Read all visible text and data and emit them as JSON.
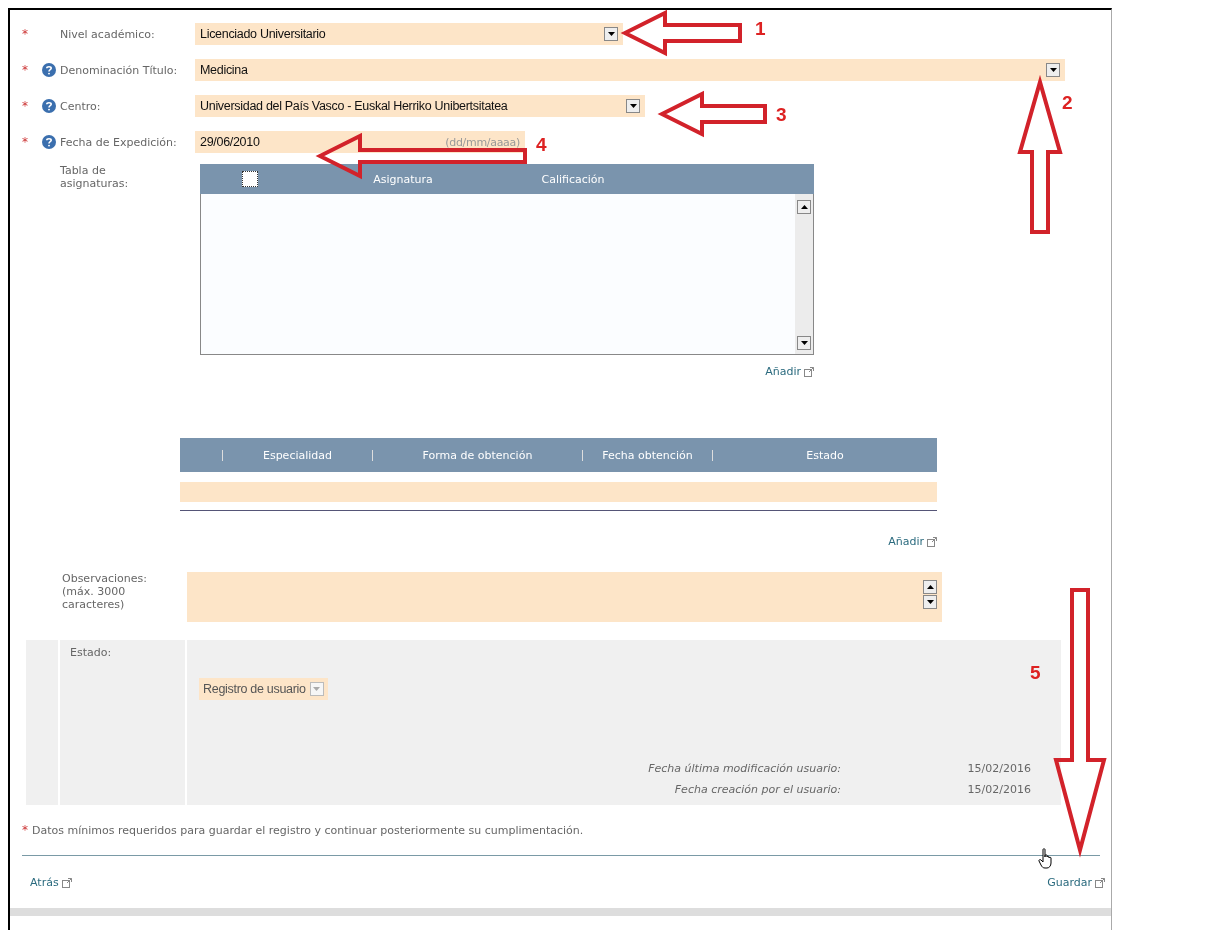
{
  "required_mark": "*",
  "form_fields": [
    {
      "kind": "select",
      "label": "Nivel académico:",
      "required": true,
      "help": false,
      "value": "Licenciado Universitario"
    },
    {
      "kind": "select",
      "label": "Denominación Título:",
      "required": true,
      "help": true,
      "value": "Medicina"
    },
    {
      "kind": "select",
      "label": "Centro:",
      "required": true,
      "help": true,
      "value": "Universidad del País Vasco - Euskal Herriko Unibertsitatea"
    },
    {
      "kind": "date",
      "label": "Fecha de Expedición:",
      "required": true,
      "help": true,
      "value": "29/06/2010",
      "format_hint": "(dd/mm/aaaa)"
    }
  ],
  "subjects_table": {
    "label": "Tabla de asignaturas:",
    "select_all_checked": false,
    "columns": [
      "Asignatura",
      "Calificación"
    ],
    "add_link": "Añadir"
  },
  "specialties_table": {
    "columns": [
      "Especialidad",
      "Forma de obtención",
      "Fecha obtención",
      "Estado"
    ],
    "add_link": "Añadir"
  },
  "observations": {
    "label": "Observaciones: (máx. 3000 caracteres)"
  },
  "status": {
    "label": "Estado:",
    "value": "Registro de usuario",
    "disabled": true
  },
  "dates": [
    {
      "label": "Fecha última modificación usuario:",
      "value": "15/02/2016"
    },
    {
      "label": "Fecha creación por el usuario:",
      "value": "15/02/2016"
    }
  ],
  "required_note": "Datos mínimos requeridos para guardar el registro y continuar posteriormente su cumplimentación.",
  "footer_links": [
    {
      "label": "Atrás"
    },
    {
      "label": "Guardar"
    }
  ],
  "annotations": [
    {
      "number": "1"
    },
    {
      "number": "2"
    },
    {
      "number": "3"
    },
    {
      "number": "4"
    },
    {
      "number": "5"
    }
  ]
}
